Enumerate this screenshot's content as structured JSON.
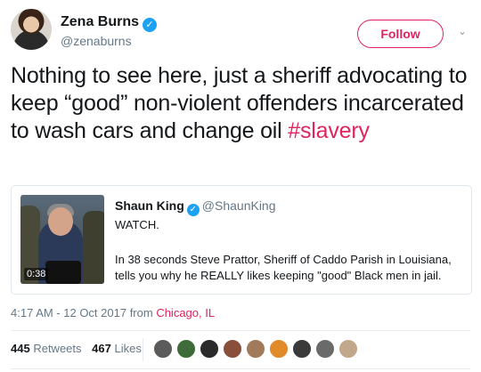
{
  "author": {
    "name": "Zena Burns",
    "handle": "@zenaburns",
    "verified_mark": "✓",
    "follow_label": "Follow",
    "caret": "⌄"
  },
  "tweet": {
    "text": "Nothing to see here, just a sheriff advocating to keep “good” non-violent offenders incarcerated to wash cars and change oil ",
    "hashtag": "#slavery"
  },
  "quoted": {
    "name": "Shaun King",
    "verified_mark": "✓",
    "handle": "@ShaunKing",
    "line1": "WATCH.",
    "body": "In 38 seconds Steve Prattor, Sheriff of Caddo Parish in Louisiana, tells you why he REALLY likes keeping \"good\" Black men in jail.",
    "video_time": "0:38"
  },
  "meta": {
    "time": "4:17 AM - 12 Oct 2017 from ",
    "location": "Chicago, IL"
  },
  "stats": {
    "retweets_count": "445",
    "retweets_label": "Retweets",
    "likes_count": "467",
    "likes_label": "Likes"
  },
  "colors": {
    "accent": "#e0245e",
    "verified": "#1da1f2",
    "muted": "#657786",
    "liker_avatars": [
      "#5b5b5b",
      "#3f6b3a",
      "#2b2b2b",
      "#8a4f3a",
      "#a07a5a",
      "#e08a2a",
      "#3a3a3a",
      "#6a6a6a",
      "#c2a88a"
    ]
  }
}
